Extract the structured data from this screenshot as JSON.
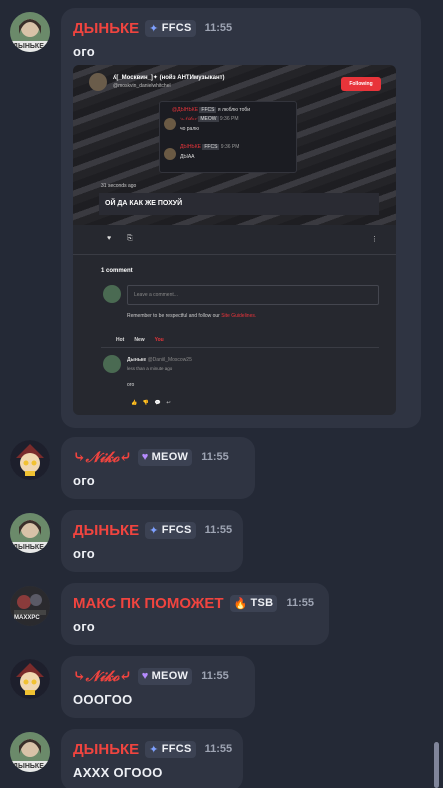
{
  "messages": [
    {
      "user": "ДЫНЬКЕ",
      "tag": "FFCS",
      "tag_icon": "sparkle-icon",
      "time": "11:55",
      "text": "ого"
    },
    {
      "user": "⤷𝒩𝒾𝓀ℴ⤶",
      "tag": "MEOW",
      "tag_icon": "heart-icon",
      "time": "11:55",
      "text": "ого"
    },
    {
      "user": "ДЫНЬКЕ",
      "tag": "FFCS",
      "tag_icon": "sparkle-icon",
      "time": "11:55",
      "text": "ого"
    },
    {
      "user": "МАКС ПК ПОМОЖЕТ",
      "tag": "TSB",
      "tag_icon": "flame-icon",
      "time": "11:55",
      "text": "ого"
    },
    {
      "user": "⤷𝒩𝒾𝓀ℴ⤶",
      "tag": "MEOW",
      "tag_icon": "heart-icon",
      "time": "11:55",
      "text": "ОООГОО"
    },
    {
      "user": "ДЫНЬКЕ",
      "tag": "FFCS",
      "tag_icon": "sparkle-icon",
      "time": "11:55",
      "text": "АХХХ ОГОOO"
    }
  ],
  "avatar_labels": {
    "dynke": "ДЫНЬКЕ",
    "maks": "MAXXPC"
  },
  "embed": {
    "author": "ʎ[_Москвин_]✦ (нойз АНТИмузыкант)",
    "handle": "@moskvin_danielwhitchel",
    "follow": "Following",
    "inner": {
      "line1_user": "@ДЫНЬКЕ",
      "line1_tag": "FFCS",
      "line1_text": "я люблю тоби",
      "line2_user": "⤷𝒩𝒾𝓀ℴ⤶",
      "line2_tag": "MEOW",
      "line2_time": "9:36 PM",
      "line2_text": "чо ралю",
      "line3_user": "ДЫНЬКЕ",
      "line3_tag": "FFCS",
      "line3_time": "9:36 PM",
      "line3_text": "ДЫАА"
    },
    "ago": "31 seconds ago",
    "caption": "ОЙ ДА КАК ЖЕ ПОХУЙ",
    "comment_count": "1 comment",
    "comment_placeholder": "Leave a comment...",
    "rules_text": "Remember to be respectful and follow our",
    "rules_link": "Site Guidelines.",
    "sorts": [
      "Hot",
      "New",
      "You"
    ],
    "comment_author": "Дыньке",
    "comment_handle": "@Daniil_Moscow25",
    "comment_time": "less than a minute ago",
    "comment_text": "ого"
  },
  "colors": {
    "accent": "#f0443f",
    "bg": "#242936",
    "bubble": "#2f3442"
  }
}
